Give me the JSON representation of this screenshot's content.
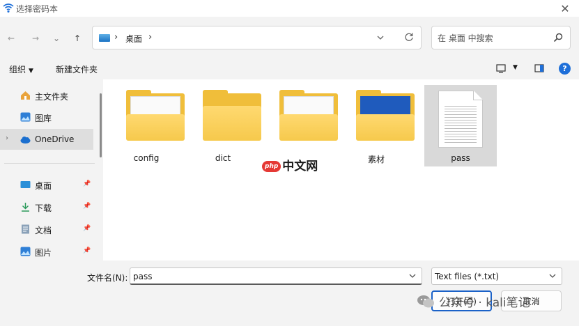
{
  "window": {
    "title": "选择密码本"
  },
  "nav": {
    "back": "←",
    "forward": "→",
    "recent": "⌄",
    "up": "↑",
    "breadcrumb": [
      "桌面"
    ],
    "search_placeholder": "在 桌面 中搜索"
  },
  "toolbar": {
    "organize": "组织",
    "new_folder": "新建文件夹"
  },
  "sidebar": {
    "items": [
      {
        "label": "主文件夹",
        "icon": "home-icon"
      },
      {
        "label": "图库",
        "icon": "gallery-icon"
      },
      {
        "label": "OneDrive",
        "icon": "cloud-icon"
      },
      {
        "label": "桌面",
        "icon": "desktop-icon"
      },
      {
        "label": "下载",
        "icon": "download-icon"
      },
      {
        "label": "文档",
        "icon": "document-icon"
      },
      {
        "label": "图片",
        "icon": "picture-icon"
      }
    ]
  },
  "files": [
    {
      "name": "config",
      "type": "folder"
    },
    {
      "name": "dict",
      "type": "folder"
    },
    {
      "name": "",
      "type": "folder"
    },
    {
      "name": "素材",
      "type": "folder"
    },
    {
      "name": "pass",
      "type": "text-file",
      "selected": true
    }
  ],
  "watermarks": {
    "site": "中文网",
    "site_logo": "php",
    "wechat": "公众号 · kali笔记"
  },
  "footer": {
    "filename_label": "文件名(N):",
    "filename_value": "pass",
    "filetype": "Text files (*.txt)",
    "open": "打开(O)",
    "cancel": "取消"
  },
  "colors": {
    "accent": "#1b62c8",
    "folder": "#f0be3a",
    "chrome": "#f3f3f3"
  }
}
